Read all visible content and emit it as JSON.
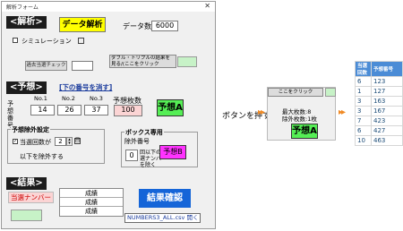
{
  "window": {
    "title": "解析フォーム",
    "close": "✕"
  },
  "analysis": {
    "header": "<解析>",
    "run_button": "データ解析",
    "data_count_label": "データ数",
    "data_count_value": "6000",
    "simulation_label": "シミュレーション",
    "past_check_button": "過去当選チェック",
    "past_check_value": "",
    "double_triple_button": "ダブル・トリプルの結果を見る/(ここをクリック"
  },
  "prediction": {
    "header": "<予想>",
    "clear_button": "[下の番号を消す]",
    "no_labels": [
      "No.1",
      "No.2",
      "No.3"
    ],
    "row_label": "予想番号",
    "numbers": [
      "14",
      "26",
      "37"
    ],
    "count_label": "予想枚数",
    "count_value": "100",
    "button": "予想A"
  },
  "exclusion": {
    "header": "予想除外設定",
    "checkbox_label": "当選回数が",
    "spin_value": "2",
    "suffix": "回",
    "bottom_label": "以下を除外する"
  },
  "box": {
    "header": "ボックス専用",
    "exclude_label": "除外番号",
    "exclude_value": "",
    "count_value": "0",
    "desc": "回以下の当選ナンバーを除く",
    "button": "予想B"
  },
  "result": {
    "header": "<結果>",
    "winning_label": "当選ナンバー",
    "rows": [
      "成績",
      "成績",
      "成績"
    ],
    "confirm_button": "結果確認",
    "file_button": "NUMBERS3_ALL.csv 開く"
  },
  "flow": {
    "push_label": "ボタンを押す",
    "snippet_button": "ここをクリック",
    "info_line1": "最大枚数:8",
    "info_line2": "除外枚数:1枚",
    "snippet_predict": "予想A"
  },
  "grid": {
    "headers": [
      "当選回数",
      "予想番号"
    ],
    "rows": [
      {
        "n": "6",
        "v": "123"
      },
      {
        "n": "1",
        "v": "127"
      },
      {
        "n": "3",
        "v": "163"
      },
      {
        "n": "3",
        "v": "167"
      },
      {
        "n": "7",
        "v": "423"
      },
      {
        "n": "6",
        "v": "427"
      },
      {
        "n": "10",
        "v": "463"
      }
    ]
  },
  "colors": {
    "section_bg": "#1c1c1c",
    "yellow": "#ffff00",
    "green": "#55ee55",
    "magenta": "#ff33ff",
    "arrow": "#f08a24",
    "grid_header": "#4b8cd6"
  }
}
